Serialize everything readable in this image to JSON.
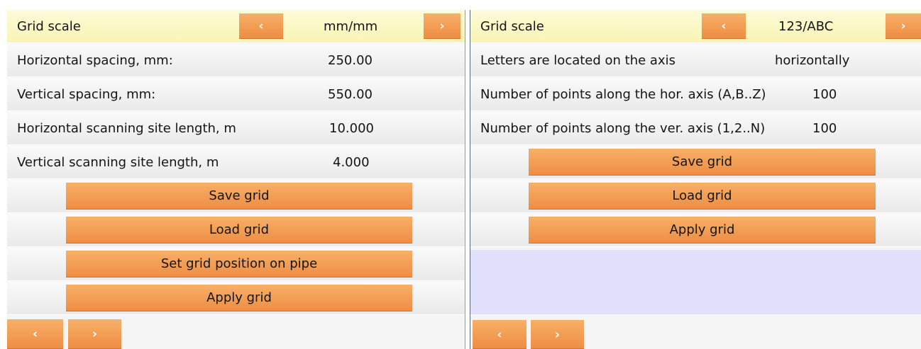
{
  "left": {
    "grid_scale_label": "Grid scale",
    "grid_scale_value": "mm/mm",
    "prev_arrow": "‹",
    "next_arrow": "›",
    "rows": [
      {
        "label": "Horizontal spacing, mm:",
        "value": "250.00"
      },
      {
        "label": "Vertical spacing, mm:",
        "value": "550.00"
      },
      {
        "label": "Horizontal scanning site length, m",
        "value": "10.000"
      },
      {
        "label": "Vertical scanning site length, m",
        "value": "4.000"
      }
    ],
    "buttons": {
      "save": "Save grid",
      "load": "Load grid",
      "set_position": "Set grid position on pipe",
      "apply": "Apply grid"
    },
    "nav_prev": "‹",
    "nav_next": "›"
  },
  "right": {
    "grid_scale_label": "Grid scale",
    "grid_scale_value": "123/ABC",
    "prev_arrow": "‹",
    "next_arrow": "›",
    "rows": [
      {
        "label": "Letters are located on the axis",
        "value": "horizontally"
      },
      {
        "label": "Number of points along the hor. axis (A,B..Z)",
        "value": "100"
      },
      {
        "label": "Number of points along the ver. axis (1,2..N)",
        "value": "100"
      }
    ],
    "buttons": {
      "save": "Save grid",
      "load": "Load grid",
      "apply": "Apply grid"
    },
    "nav_prev": "‹",
    "nav_next": "›"
  },
  "colors": {
    "button_orange": "#f29a50",
    "header_yellow": "#f9f4b4",
    "empty_lavender": "#e0e0fb",
    "row_gray": "#eaeaea"
  }
}
